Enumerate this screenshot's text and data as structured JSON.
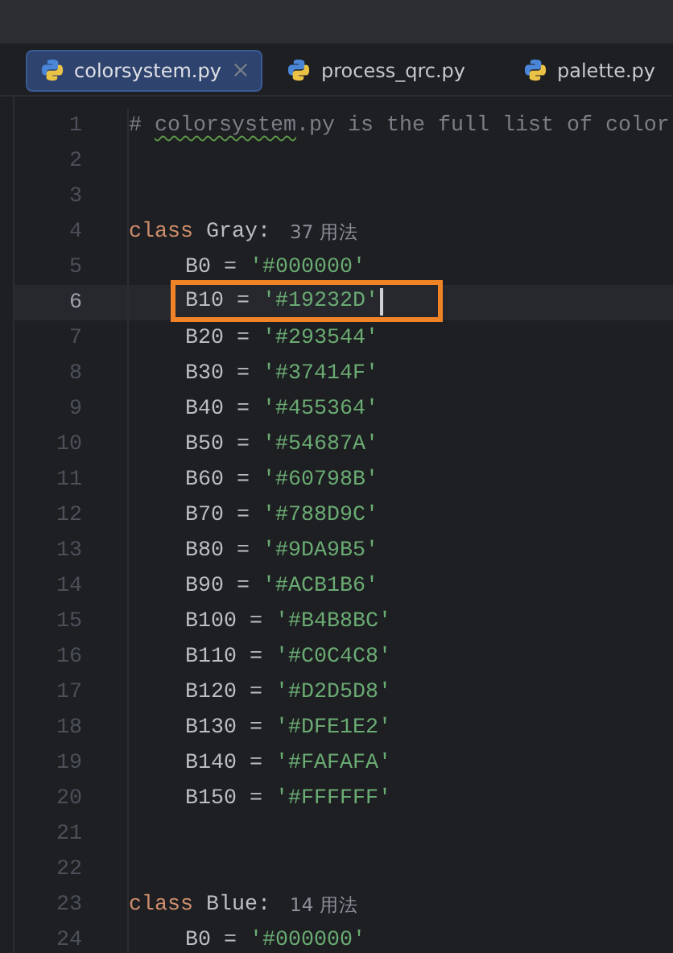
{
  "tabs": [
    {
      "label": "colorsystem.py",
      "selected": true,
      "closable": true
    },
    {
      "label": "process_qrc.py",
      "selected": false,
      "closable": false
    },
    {
      "label": "palette.py",
      "selected": false,
      "closable": false
    }
  ],
  "lines": [
    {
      "number": "1",
      "kind": "comment",
      "prefix": "# ",
      "flagged": "colorsystem",
      "rest": ".py is the full list of color"
    },
    {
      "number": "2",
      "kind": "blank"
    },
    {
      "number": "3",
      "kind": "blank"
    },
    {
      "number": "4",
      "kind": "class",
      "keyword": "class",
      "name": "Gray:",
      "usages": "37 用法",
      "children": [
        {
          "number": "5",
          "kind": "assign",
          "code": "B0 =",
          "string": "'#000000'",
          "current": false,
          "boxed": false
        },
        {
          "number": "6",
          "kind": "assign",
          "code": "B10 =",
          "string": "'#19232D'",
          "current": true,
          "boxed": true
        },
        {
          "number": "7",
          "kind": "assign",
          "code": "B20 =",
          "string": "'#293544'",
          "current": false,
          "boxed": false
        },
        {
          "number": "8",
          "kind": "assign",
          "code": "B30 =",
          "string": "'#37414F'",
          "current": false,
          "boxed": false
        },
        {
          "number": "9",
          "kind": "assign",
          "code": "B40 =",
          "string": "'#455364'",
          "current": false,
          "boxed": false
        },
        {
          "number": "10",
          "kind": "assign",
          "code": "B50 =",
          "string": "'#54687A'",
          "current": false,
          "boxed": false
        },
        {
          "number": "11",
          "kind": "assign",
          "code": "B60 =",
          "string": "'#60798B'",
          "current": false,
          "boxed": false
        },
        {
          "number": "12",
          "kind": "assign",
          "code": "B70 =",
          "string": "'#788D9C'",
          "current": false,
          "boxed": false
        },
        {
          "number": "13",
          "kind": "assign",
          "code": "B80 =",
          "string": "'#9DA9B5'",
          "current": false,
          "boxed": false
        },
        {
          "number": "14",
          "kind": "assign",
          "code": "B90 =",
          "string": "'#ACB1B6'",
          "current": false,
          "boxed": false
        },
        {
          "number": "15",
          "kind": "assign",
          "code": "B100 =",
          "string": "'#B4B8BC'",
          "current": false,
          "boxed": false
        },
        {
          "number": "16",
          "kind": "assign",
          "code": "B110 =",
          "string": "'#C0C4C8'",
          "current": false,
          "boxed": false
        },
        {
          "number": "17",
          "kind": "assign",
          "code": "B120 =",
          "string": "'#D2D5D8'",
          "current": false,
          "boxed": false
        },
        {
          "number": "18",
          "kind": "assign",
          "code": "B130 =",
          "string": "'#DFE1E2'",
          "current": false,
          "boxed": false
        },
        {
          "number": "19",
          "kind": "assign",
          "code": "B140 =",
          "string": "'#FAFAFA'",
          "current": false,
          "boxed": false
        },
        {
          "number": "20",
          "kind": "assign",
          "code": "B150 =",
          "string": "'#FFFFFF'",
          "current": false,
          "boxed": false
        }
      ]
    },
    {
      "number": "21",
      "kind": "blank"
    },
    {
      "number": "22",
      "kind": "blank"
    },
    {
      "number": "23",
      "kind": "class",
      "keyword": "class",
      "name": "Blue:",
      "usages": "14 用法",
      "children": [
        {
          "number": "24",
          "kind": "assign",
          "code": "B0 =",
          "string": "'#000000'",
          "current": false,
          "boxed": false
        }
      ]
    }
  ]
}
